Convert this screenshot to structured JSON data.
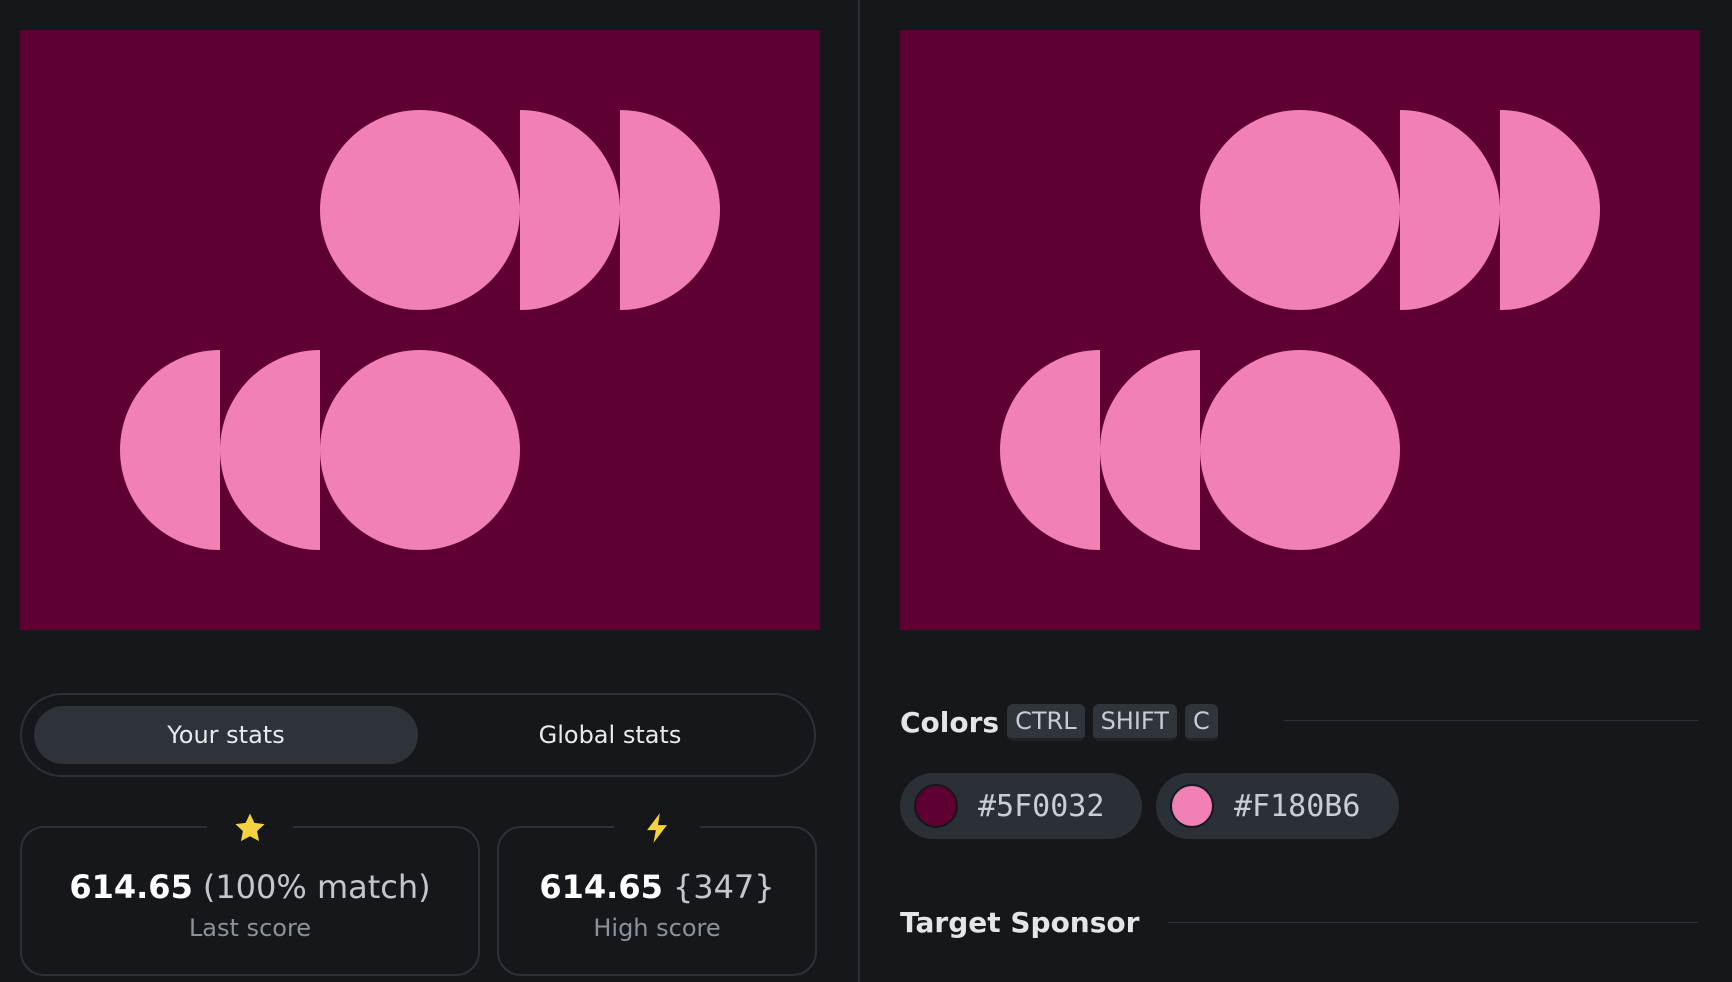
{
  "colors": {
    "background": "#5F0032",
    "shape": "#F180B6",
    "app_bg": "#15171b",
    "star": "#f5d33f",
    "bolt": "#f5d33f"
  },
  "stats_tabs": [
    {
      "label": "Your stats",
      "active": true
    },
    {
      "label": "Global stats",
      "active": false
    }
  ],
  "last_score": {
    "value": "614.65",
    "extra": "(100% match)",
    "label": "Last score",
    "icon": "star-icon"
  },
  "high_score": {
    "value": "614.65",
    "extra": "{347}",
    "label": "High score",
    "icon": "lightning-icon"
  },
  "colors_section": {
    "title": "Colors",
    "shortcut": [
      "CTRL",
      "SHIFT",
      "C"
    ],
    "swatches": [
      {
        "hex": "#5F0032"
      },
      {
        "hex": "#F180B6"
      }
    ]
  },
  "sponsor_section": {
    "title": "Target Sponsor"
  }
}
